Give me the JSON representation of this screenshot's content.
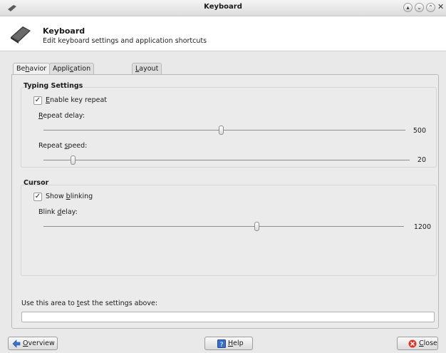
{
  "window": {
    "title": "Keyboard"
  },
  "header": {
    "title": "Keyboard",
    "subtitle": "Edit keyboard settings and application shortcuts"
  },
  "tabs": [
    {
      "pre": "Be",
      "key": "h",
      "post": "avior"
    },
    {
      "pre": "Appli",
      "key": "c",
      "post": "ation Shortcuts"
    },
    {
      "pre": "",
      "key": "L",
      "post": "ayout"
    }
  ],
  "typing": {
    "title": "Typing Settings",
    "enable_repeat": {
      "pre": "",
      "key": "E",
      "post": "nable key repeat",
      "checked": true
    },
    "repeat_delay": {
      "pre": "",
      "key": "R",
      "post": "epeat delay:",
      "value": "500",
      "fraction": 0.49
    },
    "repeat_speed": {
      "pre": "Repeat ",
      "key": "s",
      "post": "peed:",
      "value": "20",
      "fraction": 0.08
    }
  },
  "cursor": {
    "title": "Cursor",
    "show_blinking": {
      "pre": "Show ",
      "key": "b",
      "post": "linking",
      "checked": true
    },
    "blink_delay": {
      "pre": "Blink ",
      "key": "d",
      "post": "elay:",
      "value": "1200",
      "fraction": 0.59
    }
  },
  "test_area": {
    "pre": "Use this area to ",
    "key": "t",
    "post": "est the settings above:"
  },
  "buttons": {
    "overview": {
      "pre": "",
      "key": "O",
      "post": "verview"
    },
    "help": {
      "pre": "",
      "key": "H",
      "post": "elp"
    },
    "close": {
      "pre": "",
      "key": "C",
      "post": "lose"
    }
  },
  "colors": {
    "close_icon": "#d8382c",
    "help_icon": "#3a6fc4",
    "overview_icon": "#3d74c9"
  }
}
